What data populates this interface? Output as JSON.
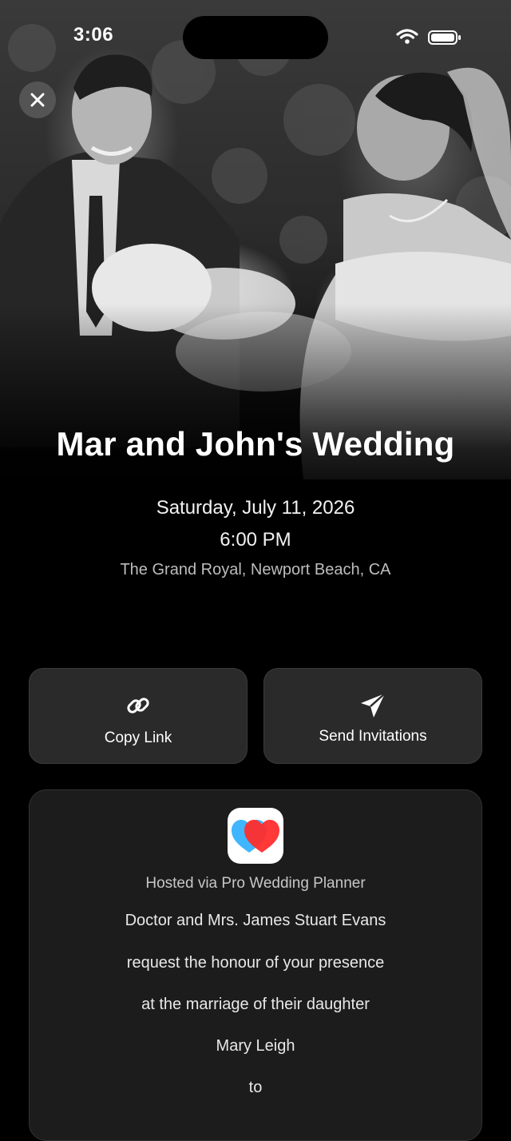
{
  "status_bar": {
    "time": "3:06",
    "icons": [
      "wifi-icon",
      "battery-icon"
    ]
  },
  "hero": {
    "image": "black-and-white wedding couple photo",
    "close_icon": "close-icon"
  },
  "event": {
    "title": "Mar and John's Wedding",
    "date": "Saturday, July 11, 2026",
    "time": "6:00 PM",
    "venue": "The Grand Royal, Newport Beach, CA"
  },
  "actions": {
    "copy_link": {
      "label": "Copy Link",
      "icon": "link-icon"
    },
    "send_invitations": {
      "label": "Send Invitations",
      "icon": "paper-plane-icon"
    }
  },
  "invitation_card": {
    "app_icon": "hearts-app-icon",
    "hosted_via": "Hosted via Pro Wedding Planner",
    "lines": [
      "Doctor and Mrs. James Stuart Evans",
      "request the honour of your presence",
      "at the marriage of their daughter",
      "Mary Leigh",
      "to"
    ]
  },
  "colors": {
    "background": "#000000",
    "button_bg": "#2a2a2a",
    "card_bg": "#1c1c1c",
    "heart_blue": "#3fb6ff",
    "heart_red": "#ff2d2d"
  }
}
